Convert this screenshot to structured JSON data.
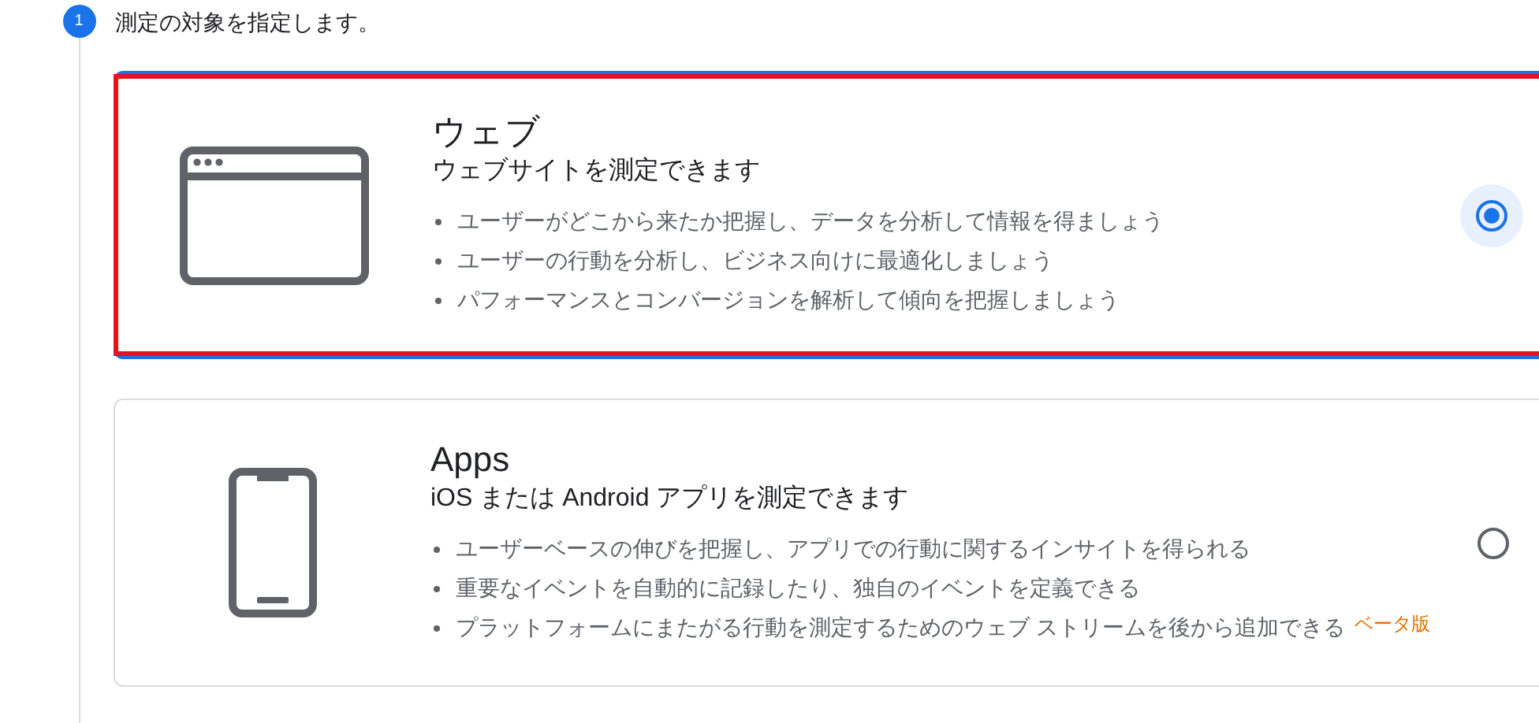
{
  "step": {
    "number": "1",
    "title": "測定の対象を指定します。"
  },
  "options": [
    {
      "kind": "web",
      "title": "ウェブ",
      "subtitle": "ウェブサイトを測定できます",
      "selected": true,
      "highlighted": true,
      "bullets": [
        {
          "text": "ユーザーがどこから来たか把握し、データを分析して情報を得ましょう"
        },
        {
          "text": "ユーザーの行動を分析し、ビジネス向けに最適化しましょう"
        },
        {
          "text": "パフォーマンスとコンバージョンを解析して傾向を把握しましょう"
        }
      ]
    },
    {
      "kind": "app",
      "title": "Apps",
      "subtitle": "iOS または Android アプリを測定できます",
      "selected": false,
      "highlighted": false,
      "bullets": [
        {
          "text": "ユーザーベースの伸びを把握し、アプリでの行動に関するインサイトを得られる"
        },
        {
          "text": "重要なイベントを自動的に記録したり、独自のイベントを定義できる"
        },
        {
          "text": "プラットフォームにまたがる行動を測定するためのウェブ ストリームを後から追加できる",
          "badge": "ベータ版"
        }
      ]
    }
  ]
}
